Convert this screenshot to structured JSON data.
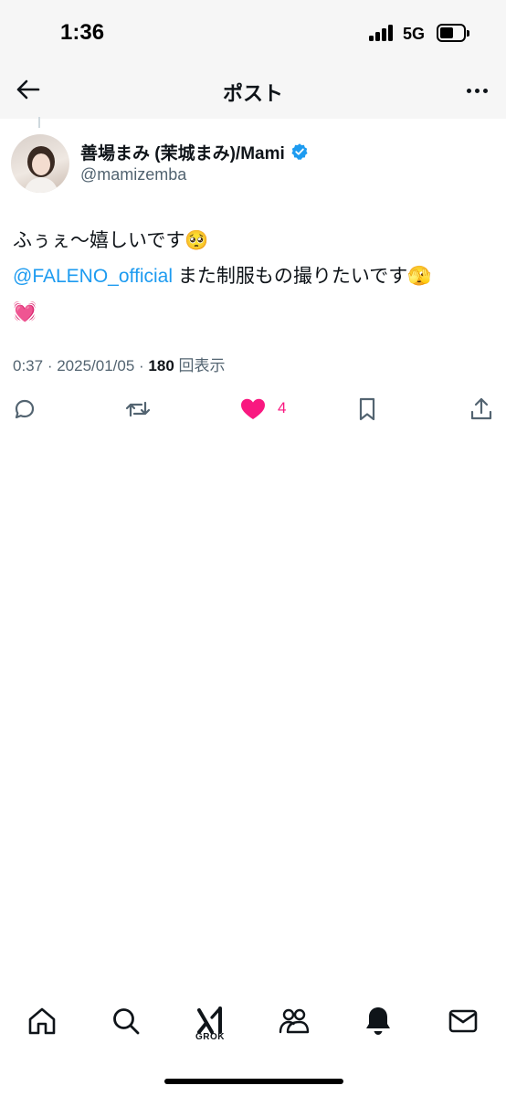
{
  "status_bar": {
    "time": "1:36",
    "network": "5G"
  },
  "header": {
    "title": "ポスト"
  },
  "author": {
    "display_name": "善場まみ (茉城まみ)/Mami",
    "handle": "@mamizemba"
  },
  "tweet": {
    "line1": "ふぅぇ〜嬉しいです🥺",
    "mention": "@FALENO_official",
    "line2_rest": " また制服もの撮りたいです🫣",
    "line3": "💓"
  },
  "meta": {
    "time": "0:37",
    "date": "2025/01/05",
    "views_count": "180",
    "views_label": "回表示",
    "separator": " · "
  },
  "actions": {
    "like_count": "4"
  },
  "bottom_nav": {
    "grok_label": "GROK"
  },
  "colors": {
    "accent": "#1d9bf0",
    "like": "#f91880",
    "text": "#0f1419",
    "muted": "#536471",
    "header_bg": "#f6f6f6"
  }
}
